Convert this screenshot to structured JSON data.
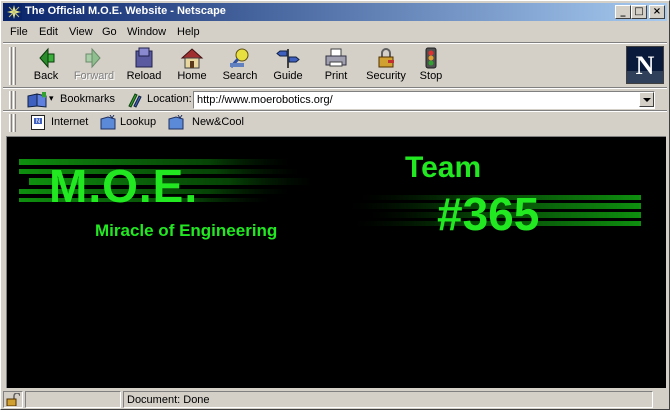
{
  "window": {
    "title": "The Official M.O.E. Website - Netscape"
  },
  "menubar": {
    "items": [
      "File",
      "Edit",
      "View",
      "Go",
      "Window",
      "Help"
    ]
  },
  "toolbar": {
    "back": "Back",
    "forward": "Forward",
    "reload": "Reload",
    "home": "Home",
    "search": "Search",
    "guide": "Guide",
    "print": "Print",
    "security": "Security",
    "stop": "Stop"
  },
  "locationbar": {
    "bookmarks": "Bookmarks",
    "location_label": "Location:",
    "url": "http://www.moerobotics.org/"
  },
  "personalbar": {
    "items": [
      "Internet",
      "Lookup",
      "New&Cool"
    ]
  },
  "content": {
    "title": "M.O.E.",
    "subtitle": "Miracle of Engineering",
    "team_label": "Team",
    "team_number": "#365",
    "accent_color": "#22e822"
  },
  "statusbar": {
    "status": "Document: Done"
  }
}
